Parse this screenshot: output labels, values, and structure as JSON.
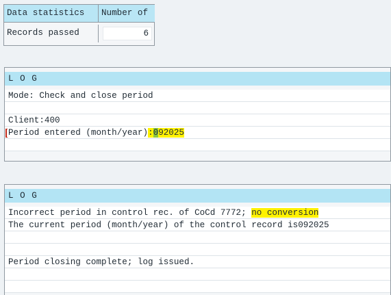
{
  "stats": {
    "headers": [
      "Data statistics",
      "Number of"
    ],
    "rows": [
      {
        "label": "Records passed",
        "value": "6"
      }
    ]
  },
  "log1": {
    "title": "L O G",
    "lines": [
      "Mode: Check and close period",
      "",
      "Client:400",
      "Period entered (month/year):092025"
    ]
  },
  "log2": {
    "title": "L O G",
    "lines": [
      "Incorrect period in control rec. of CoCd 7772; no conversion",
      "The current period (month/year) of the control record is092025",
      "",
      "",
      "Period closing complete; log issued."
    ]
  },
  "colors": {
    "header_bg": "#b9e6f5",
    "highlight": "#fff200",
    "cursor": "#c12a1a"
  }
}
